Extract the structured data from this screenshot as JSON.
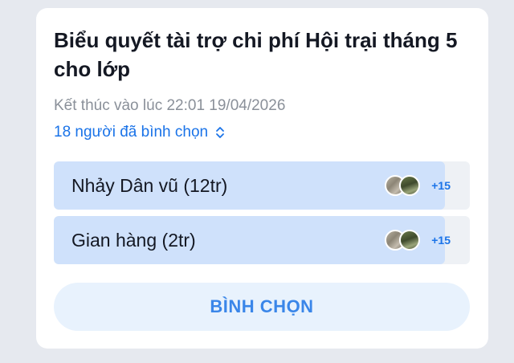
{
  "poll": {
    "title": "Biểu quyết tài trợ chi phí Hội trại tháng 5 cho lớp",
    "deadline": "Kết thúc vào lúc 22:01 19/04/2026",
    "voters_label": "18 người đã bình chọn",
    "options": [
      {
        "label": "Nhảy Dân vũ (12tr)",
        "extra_voters": "+15",
        "vote_share": 0.94
      },
      {
        "label": "Gian hàng (2tr)",
        "extra_voters": "+15",
        "vote_share": 0.94
      }
    ],
    "vote_button_label": "BÌNH CHỌN"
  },
  "colors": {
    "accent": "#1a73e8",
    "bar_fill": "#cfe1fb",
    "button_bg": "#e8f2fd"
  },
  "icons": {
    "voters_toggle": "chevron-up-down-icon"
  }
}
